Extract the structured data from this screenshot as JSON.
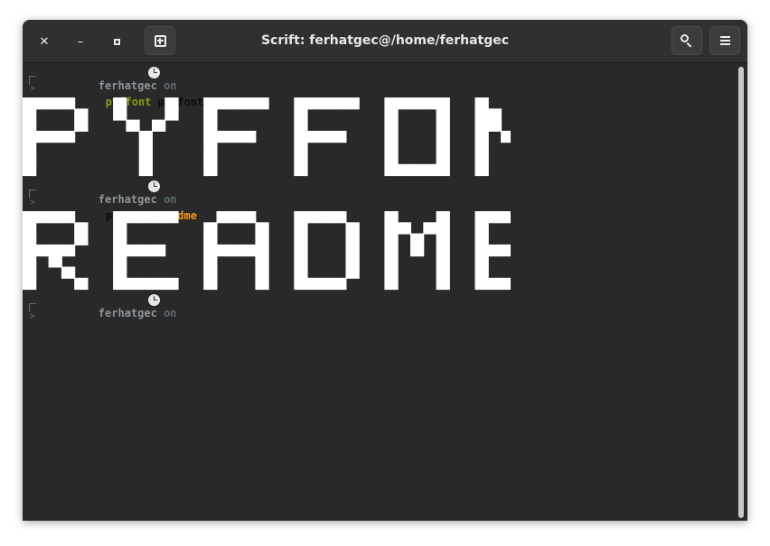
{
  "window": {
    "title": "Scrift: ferhatgec@/home/ferhatgec",
    "controls": {
      "close": "✕",
      "minimize": "–",
      "maximize": "▫"
    },
    "new_tab_icon": "new-tab-icon",
    "search_icon": "search-icon",
    "menu_icon": "hamburger-menu-icon"
  },
  "theme": {
    "background": "#292929",
    "titlebar": "#303030",
    "user_color": "#8c959b",
    "green": "#8a9a1a",
    "orange": "#f39a1c",
    "banner": "#ffffff"
  },
  "terminal": {
    "prompts": [
      {
        "user": "ferhatgec",
        "on": "on",
        "arrow": ">",
        "cmd": "pyffont",
        "arg": "pyffont"
      },
      {
        "user": "ferhatgec",
        "on": "on",
        "arrow": ">",
        "cmd": "pyffont",
        "arg": "readme"
      },
      {
        "user": "ferhatgec",
        "on": "on",
        "arrow": ">"
      }
    ],
    "banners": [
      "PYFFONT",
      "README"
    ]
  }
}
